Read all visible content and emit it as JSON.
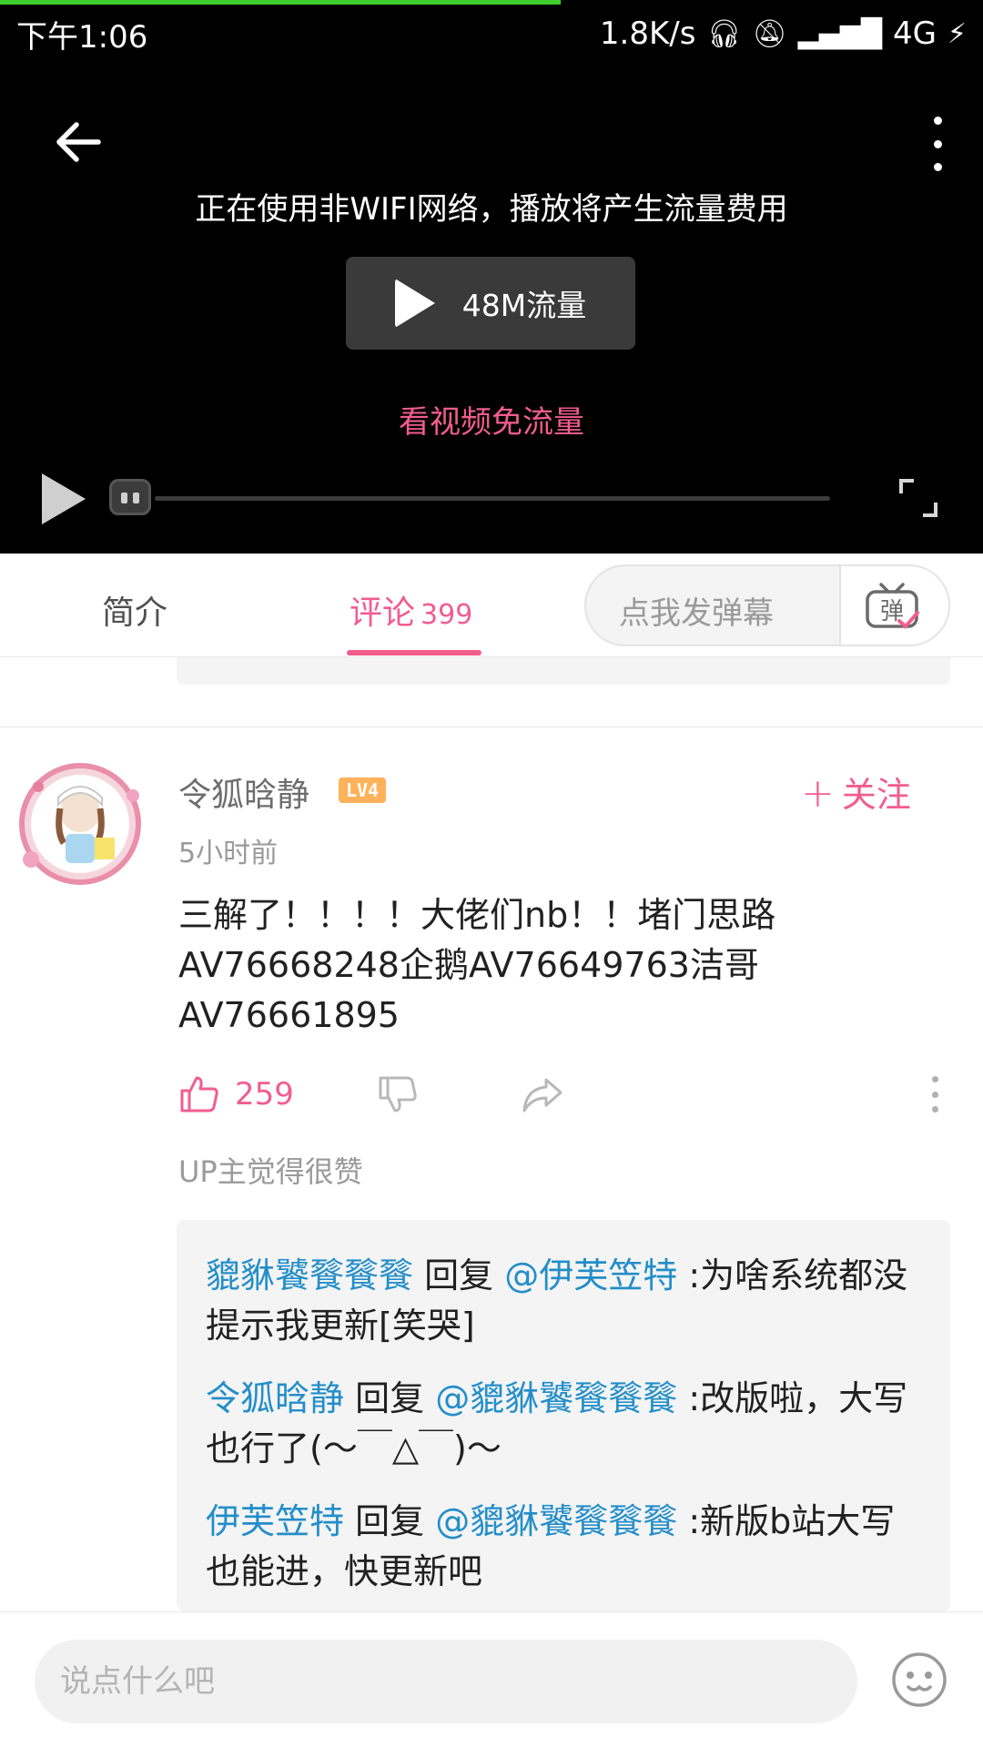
{
  "status_bar": {
    "time": "下午1:06",
    "net_speed": "1.8K/s",
    "network": "4G"
  },
  "player": {
    "warning": "正在使用非WIFI网络，播放将产生流量费用",
    "play_label": "48M流量",
    "free_data_link": "看视频免流量",
    "load_progress": 0.57
  },
  "tabs": {
    "intro": "简介",
    "comments": "评论",
    "comment_count": "399",
    "danmaku_placeholder": "点我发弹幕",
    "danmaku_icon_char": "弹"
  },
  "comment": {
    "user": "令狐晗静",
    "level": "LV4",
    "follow": "关注",
    "time": "5小时前",
    "lines": [
      "三解了！！！！大佬们nb！！堵门思路",
      "AV76668248企鹅AV76649763洁哥",
      "AV76661895"
    ],
    "likes": "259",
    "up_liked": "UP主觉得很赞"
  },
  "replies": [
    {
      "user": "貔貅饕餮餮餮",
      "verb": "回复",
      "target": "@伊芙笠特",
      "text": ":为啥系统都没提示我更新[笑哭]"
    },
    {
      "user": "令狐晗静",
      "verb": "回复",
      "target": "@貔貅饕餮餮餮",
      "text": ":改版啦，大写也行了(～￣△￣)～"
    },
    {
      "user": "伊芙笠特",
      "verb": "回复",
      "target": "@貔貅饕餮餮餮",
      "text": ":新版b站大写也能进，快更新吧"
    }
  ],
  "bottom": {
    "placeholder": "说点什么吧"
  },
  "colors": {
    "accent_pink": "#f25d8e",
    "link_blue": "#238ec9",
    "level_orange": "#ffb259",
    "load_green": "#3ecf2c"
  }
}
